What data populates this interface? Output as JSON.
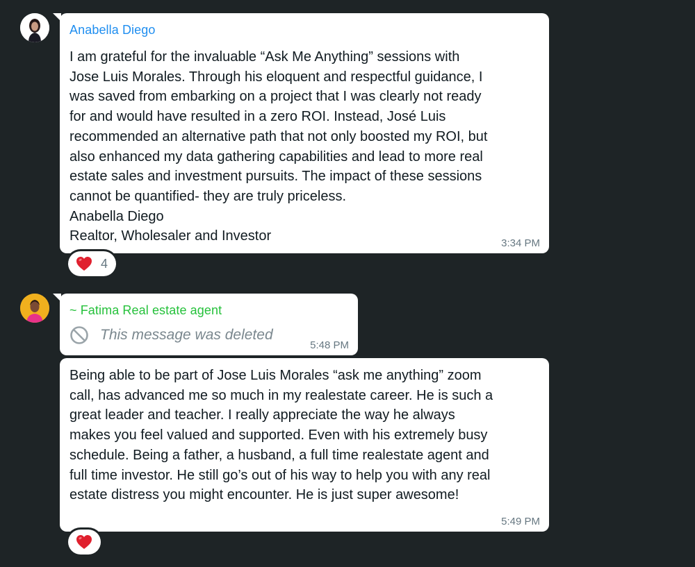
{
  "messages": [
    {
      "sender": "Anabella Diego",
      "text": "I am grateful for the invaluable “Ask Me Anything” sessions with\nJose Luis Morales. Through his eloquent and respectful guidance, I\nwas saved from embarking on a project that I was clearly not ready\nfor and would have resulted in a zero ROI. Instead, José Luis\nrecommended an alternative path that not only boosted my ROI, but\nalso enhanced my data gathering capabilities and lead to more real\nestate sales and investment pursuits. The impact of these sessions\ncannot be quantified- they are truly priceless.\nAnabella Diego\nRealtor, Wholesaler and Investor",
      "time": "3:34 PM",
      "reaction": {
        "emoji": "heart-icon",
        "count": "4"
      }
    },
    {
      "sender": "~ Fatima Real estate agent",
      "deleted_text": "This message was deleted",
      "time": "5:48 PM"
    },
    {
      "text": "Being able to be part of Jose Luis Morales “ask me anything” zoom\ncall, has advanced me so much in my realestate career. He is such a\ngreat leader and teacher. I really appreciate the way he always\nmakes you feel valued and supported. Even with his extremely busy\nschedule. Being a father, a husband, a full time realestate agent and\nfull time investor. He still go’s out of his way to help you with any real\nestate distress you might encounter.  He is just super awesome!",
      "time": "5:49 PM",
      "reaction": {
        "emoji": "heart-icon"
      }
    }
  ],
  "colors": {
    "background": "#1e2426",
    "bubble": "#ffffff",
    "sender_1": "#1f8ef0",
    "sender_2": "#25c13b",
    "timestamp": "#667781",
    "heart": "#e0202e"
  }
}
